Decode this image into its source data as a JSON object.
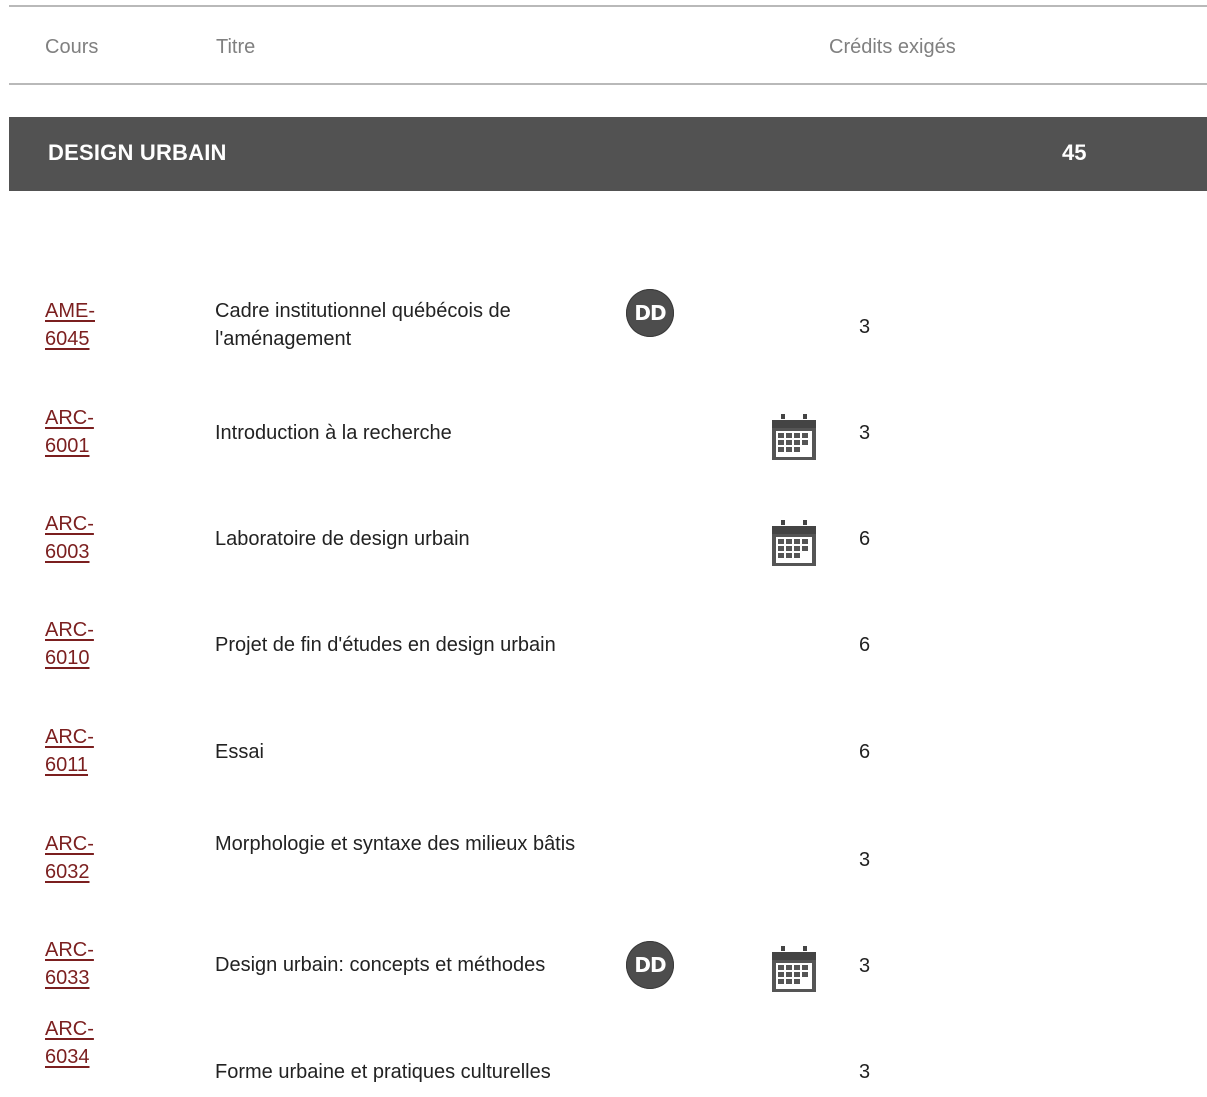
{
  "table_header": {
    "course_col": "Cours",
    "title_col": "Titre",
    "credits_col": "Crédits exigés"
  },
  "section": {
    "title": "DESIGN URBAIN",
    "credits": "45"
  },
  "badge_label": "DD",
  "courses": [
    {
      "code_prefix": "AME-",
      "code_number": "6045",
      "title": "Cadre institutionnel québécois de l'aménagement",
      "credits": "3",
      "badge": true,
      "calendar": false
    },
    {
      "code_prefix": "ARC-",
      "code_number": "6001",
      "title": "Introduction à la recherche",
      "credits": "3",
      "badge": false,
      "calendar": true
    },
    {
      "code_prefix": "ARC-",
      "code_number": "6003",
      "title": "Laboratoire de design urbain",
      "credits": "6",
      "badge": false,
      "calendar": true
    },
    {
      "code_prefix": "ARC-",
      "code_number": "6010",
      "title": "Projet de fin d'études en design urbain",
      "credits": "6",
      "badge": false,
      "calendar": false
    },
    {
      "code_prefix": "ARC-",
      "code_number": "6011",
      "title": "Essai",
      "credits": "6",
      "badge": false,
      "calendar": false
    },
    {
      "code_prefix": "ARC-",
      "code_number": "6032",
      "title": "Morphologie et syntaxe des milieux bâtis",
      "credits": "3",
      "badge": false,
      "calendar": false
    },
    {
      "code_prefix": "ARC-",
      "code_number": "6033",
      "title": "Design urbain: concepts et méthodes",
      "credits": "3",
      "badge": true,
      "calendar": true
    },
    {
      "code_prefix": "ARC-",
      "code_number": "6034",
      "title": "Forme urbaine et pratiques culturelles",
      "credits": "3",
      "badge": false,
      "calendar": false
    }
  ],
  "icons": {
    "badge": "dd-badge-icon",
    "calendar": "calendar-icon"
  }
}
